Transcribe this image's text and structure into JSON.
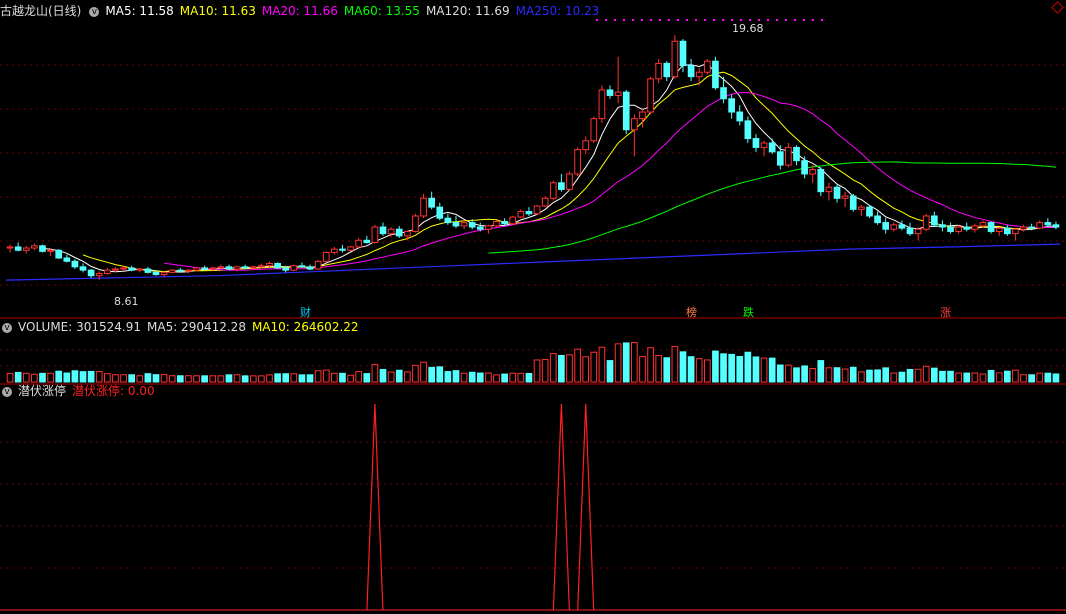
{
  "header": {
    "title": "古越龙山(日线)",
    "ma_items": [
      {
        "label": "MA5: 11.58",
        "color": "#ffffff"
      },
      {
        "label": "MA10: 11.63",
        "color": "#ffff00"
      },
      {
        "label": "MA20: 11.66",
        "color": "#ff00ff"
      },
      {
        "label": "MA60: 13.55",
        "color": "#00ff00"
      },
      {
        "label": "MA120: 11.69",
        "color": "#dddddd"
      },
      {
        "label": "MA250: 10.23",
        "color": "#2b2bff"
      }
    ]
  },
  "volume_header": {
    "items": [
      {
        "label": "VOLUME: 301524.91",
        "color": "#dddddd"
      },
      {
        "label": "MA5: 290412.28",
        "color": "#dddddd"
      },
      {
        "label": "MA10: 264602.22",
        "color": "#ffff00"
      }
    ]
  },
  "indicator_header": {
    "title": "潜伏涨停",
    "value_label": "潜伏涨停: 0.00",
    "value_color": "#ff2020"
  },
  "annotations": {
    "high": "19.68",
    "low": "8.61",
    "tags": [
      {
        "text": "财",
        "color": "#00c8ff"
      },
      {
        "text": "榜",
        "color": "#ff8040"
      },
      {
        "text": "跌",
        "color": "#00ff00"
      },
      {
        "text": "涨",
        "color": "#ff4040"
      }
    ]
  },
  "chart_data": {
    "type": "candlestick",
    "price_range": [
      7.7,
      20.0
    ],
    "candles": [
      [
        10.05,
        10.2,
        9.85,
        10.1
      ],
      [
        10.1,
        10.3,
        9.9,
        9.95
      ],
      [
        9.95,
        10.15,
        9.8,
        10.05
      ],
      [
        10.05,
        10.25,
        9.95,
        10.15
      ],
      [
        10.15,
        10.2,
        9.85,
        9.9
      ],
      [
        9.9,
        10.05,
        9.7,
        9.95
      ],
      [
        9.95,
        10.0,
        9.55,
        9.6
      ],
      [
        9.6,
        9.75,
        9.4,
        9.45
      ],
      [
        9.45,
        9.55,
        9.1,
        9.2
      ],
      [
        9.2,
        9.35,
        8.95,
        9.05
      ],
      [
        9.05,
        9.1,
        8.7,
        8.8
      ],
      [
        8.8,
        9.0,
        8.61,
        8.9
      ],
      [
        8.9,
        9.15,
        8.85,
        9.05
      ],
      [
        9.05,
        9.2,
        8.95,
        9.1
      ],
      [
        9.1,
        9.25,
        9.0,
        9.15
      ],
      [
        9.15,
        9.25,
        9.0,
        9.05
      ],
      [
        9.05,
        9.15,
        8.95,
        9.1
      ],
      [
        9.1,
        9.2,
        8.9,
        8.95
      ],
      [
        8.95,
        9.05,
        8.8,
        8.85
      ],
      [
        8.85,
        9.0,
        8.75,
        8.95
      ],
      [
        8.95,
        9.1,
        8.9,
        9.05
      ],
      [
        9.05,
        9.15,
        8.95,
        9.0
      ],
      [
        9.0,
        9.1,
        8.9,
        9.05
      ],
      [
        9.05,
        9.2,
        9.0,
        9.15
      ],
      [
        9.15,
        9.25,
        9.05,
        9.1
      ],
      [
        9.1,
        9.2,
        9.0,
        9.15
      ],
      [
        9.15,
        9.3,
        9.1,
        9.2
      ],
      [
        9.2,
        9.3,
        9.05,
        9.1
      ],
      [
        9.1,
        9.25,
        9.0,
        9.2
      ],
      [
        9.2,
        9.3,
        9.1,
        9.15
      ],
      [
        9.15,
        9.25,
        9.05,
        9.2
      ],
      [
        9.2,
        9.35,
        9.15,
        9.25
      ],
      [
        9.25,
        9.45,
        9.2,
        9.35
      ],
      [
        9.35,
        9.4,
        9.1,
        9.15
      ],
      [
        9.15,
        9.25,
        8.95,
        9.05
      ],
      [
        9.05,
        9.3,
        9.0,
        9.25
      ],
      [
        9.25,
        9.4,
        9.15,
        9.2
      ],
      [
        9.2,
        9.3,
        9.05,
        9.1
      ],
      [
        9.1,
        9.5,
        9.05,
        9.45
      ],
      [
        9.45,
        9.9,
        9.4,
        9.85
      ],
      [
        9.85,
        10.1,
        9.75,
        10.0
      ],
      [
        10.0,
        10.2,
        9.85,
        9.95
      ],
      [
        9.95,
        10.15,
        9.9,
        10.1
      ],
      [
        10.1,
        10.5,
        10.05,
        10.4
      ],
      [
        10.4,
        10.6,
        10.25,
        10.3
      ],
      [
        10.3,
        11.1,
        10.25,
        11.0
      ],
      [
        11.0,
        11.2,
        10.6,
        10.7
      ],
      [
        10.7,
        11.0,
        10.55,
        10.9
      ],
      [
        10.9,
        11.05,
        10.5,
        10.6
      ],
      [
        10.6,
        10.85,
        10.4,
        10.8
      ],
      [
        10.8,
        11.6,
        10.75,
        11.5
      ],
      [
        11.5,
        12.5,
        11.4,
        12.3
      ],
      [
        12.3,
        12.6,
        11.8,
        11.9
      ],
      [
        11.9,
        12.1,
        11.3,
        11.4
      ],
      [
        11.4,
        11.6,
        11.1,
        11.2
      ],
      [
        11.2,
        11.5,
        10.95,
        11.05
      ],
      [
        11.05,
        11.3,
        10.9,
        11.2
      ],
      [
        11.2,
        11.35,
        10.9,
        11.0
      ],
      [
        11.0,
        11.2,
        10.8,
        10.9
      ],
      [
        10.9,
        11.1,
        10.7,
        11.05
      ],
      [
        11.05,
        11.3,
        11.0,
        11.25
      ],
      [
        11.25,
        11.4,
        11.05,
        11.15
      ],
      [
        11.15,
        11.5,
        11.1,
        11.45
      ],
      [
        11.45,
        11.8,
        11.4,
        11.7
      ],
      [
        11.7,
        11.9,
        11.5,
        11.6
      ],
      [
        11.6,
        12.0,
        11.55,
        11.95
      ],
      [
        11.95,
        12.4,
        11.9,
        12.3
      ],
      [
        12.3,
        13.1,
        12.2,
        13.0
      ],
      [
        13.0,
        13.4,
        12.6,
        12.7
      ],
      [
        12.7,
        13.5,
        12.65,
        13.4
      ],
      [
        13.4,
        14.6,
        13.3,
        14.5
      ],
      [
        14.5,
        15.1,
        14.3,
        14.9
      ],
      [
        14.9,
        16.0,
        14.8,
        15.9
      ],
      [
        15.9,
        17.4,
        15.7,
        17.2
      ],
      [
        17.2,
        17.4,
        16.8,
        16.95
      ],
      [
        16.95,
        18.7,
        16.6,
        17.1
      ],
      [
        17.1,
        17.2,
        15.2,
        15.4
      ],
      [
        15.4,
        16.1,
        14.2,
        15.9
      ],
      [
        15.9,
        16.4,
        15.5,
        16.2
      ],
      [
        16.2,
        17.8,
        16.1,
        17.7
      ],
      [
        17.7,
        18.6,
        17.5,
        18.4
      ],
      [
        18.4,
        18.5,
        17.6,
        17.8
      ],
      [
        17.8,
        19.68,
        17.7,
        19.4
      ],
      [
        19.4,
        19.5,
        18.0,
        18.3
      ],
      [
        18.3,
        18.6,
        17.6,
        17.8
      ],
      [
        17.8,
        18.2,
        17.4,
        18.0
      ],
      [
        18.0,
        18.6,
        17.9,
        18.5
      ],
      [
        18.5,
        18.7,
        17.2,
        17.3
      ],
      [
        17.3,
        17.8,
        16.6,
        16.8
      ],
      [
        16.8,
        17.0,
        15.9,
        16.2
      ],
      [
        16.2,
        16.5,
        15.6,
        15.8
      ],
      [
        15.8,
        16.0,
        14.8,
        15.0
      ],
      [
        15.0,
        15.2,
        14.4,
        14.6
      ],
      [
        14.6,
        14.9,
        14.2,
        14.8
      ],
      [
        14.8,
        15.0,
        14.3,
        14.4
      ],
      [
        14.4,
        14.7,
        13.6,
        13.8
      ],
      [
        13.8,
        14.8,
        13.7,
        14.6
      ],
      [
        14.6,
        14.7,
        13.8,
        14.0
      ],
      [
        14.0,
        14.2,
        13.2,
        13.4
      ],
      [
        13.4,
        13.8,
        13.0,
        13.6
      ],
      [
        13.6,
        13.7,
        12.4,
        12.6
      ],
      [
        12.6,
        13.0,
        12.2,
        12.8
      ],
      [
        12.8,
        12.9,
        12.1,
        12.3
      ],
      [
        12.3,
        12.6,
        11.9,
        12.4
      ],
      [
        12.4,
        12.5,
        11.7,
        11.8
      ],
      [
        11.8,
        12.0,
        11.5,
        11.9
      ],
      [
        11.9,
        12.0,
        11.4,
        11.5
      ],
      [
        11.5,
        11.7,
        11.1,
        11.2
      ],
      [
        11.2,
        11.4,
        10.7,
        10.9
      ],
      [
        10.9,
        11.2,
        10.8,
        11.1
      ],
      [
        11.1,
        11.3,
        10.85,
        10.95
      ],
      [
        10.95,
        11.2,
        10.6,
        10.7
      ],
      [
        10.7,
        11.0,
        10.4,
        10.9
      ],
      [
        10.9,
        11.6,
        10.8,
        11.5
      ],
      [
        11.5,
        11.7,
        11.0,
        11.1
      ],
      [
        11.1,
        11.3,
        10.8,
        11.0
      ],
      [
        11.0,
        11.2,
        10.7,
        10.8
      ],
      [
        10.8,
        11.1,
        10.7,
        11.0
      ],
      [
        11.0,
        11.2,
        10.8,
        10.9
      ],
      [
        10.9,
        11.15,
        10.75,
        11.05
      ],
      [
        11.05,
        11.3,
        10.95,
        11.2
      ],
      [
        11.2,
        11.25,
        10.7,
        10.8
      ],
      [
        10.8,
        11.0,
        10.6,
        10.95
      ],
      [
        10.95,
        11.1,
        10.6,
        10.7
      ],
      [
        10.7,
        10.95,
        10.4,
        10.9
      ],
      [
        10.9,
        11.1,
        10.8,
        11.0
      ],
      [
        11.0,
        11.15,
        10.85,
        10.95
      ],
      [
        10.95,
        11.3,
        10.9,
        11.2
      ],
      [
        11.2,
        11.4,
        11.0,
        11.1
      ],
      [
        11.1,
        11.25,
        10.9,
        11.0
      ]
    ],
    "ma_lines": [
      {
        "name": "MA5",
        "color": "#ffffff",
        "values": [
          11.58
        ]
      },
      {
        "name": "MA10",
        "color": "#ffff00",
        "values": [
          11.63
        ]
      },
      {
        "name": "MA20",
        "color": "#ff00ff",
        "values": [
          11.66
        ]
      },
      {
        "name": "MA60",
        "color": "#00ff00",
        "values": [
          13.55
        ]
      },
      {
        "name": "MA120",
        "color": "#dddddd",
        "values": [
          11.69
        ]
      },
      {
        "name": "MA250",
        "color": "#2b2bff",
        "values": [
          8.6,
          8.7,
          8.8,
          9.0,
          9.2,
          9.4,
          9.6,
          9.8,
          10.0,
          10.1,
          10.23
        ]
      }
    ],
    "volume_range": [
      0,
      650000
    ],
    "volume_last": 301524.91,
    "indicator_spikes": [
      {
        "candle": 45,
        "value": 1
      },
      {
        "candle": 68,
        "value": 1
      },
      {
        "candle": 71,
        "value": 1
      }
    ]
  }
}
